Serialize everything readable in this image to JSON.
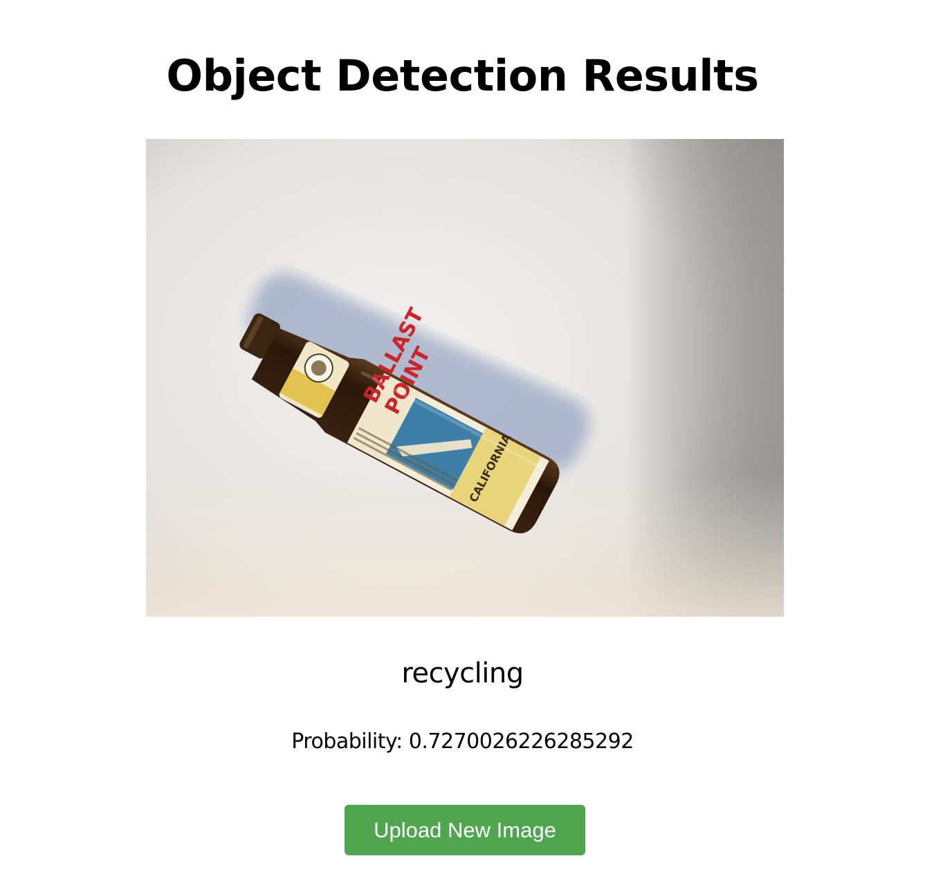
{
  "page": {
    "title": "Object Detection Results"
  },
  "result": {
    "label": "recycling",
    "probability_prefix": "Probability:",
    "probability_value": "0.7270026226285292",
    "image_label_text": {
      "brand_line1": "BALLAST",
      "brand_line2": "POINT",
      "side_text": "CALIFORNIA"
    }
  },
  "actions": {
    "upload_label": "Upload New Image"
  },
  "colors": {
    "button_bg": "#4fa64f",
    "button_text": "#ffffff",
    "text": "#000000"
  }
}
